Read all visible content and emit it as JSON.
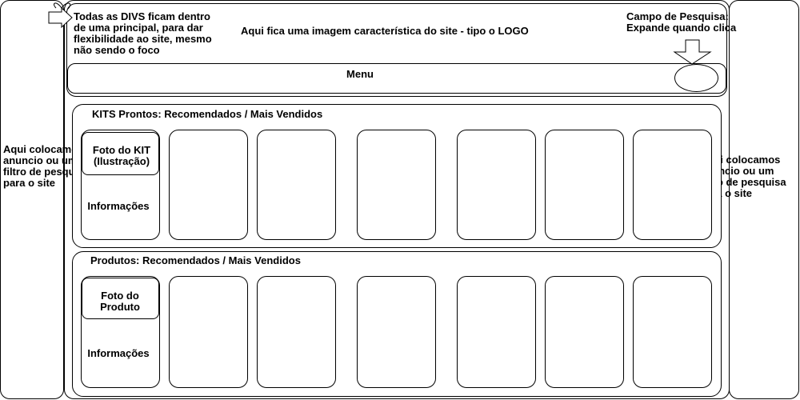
{
  "main_note": "Todas as DIVS ficam dentro\nde uma principal, para dar\nflexibilidade ao site, mesmo\nnão sendo o foco",
  "logo_note": "Aqui fica uma imagem característica do site - tipo o LOGO",
  "search_note": "Campo de Pesquisa:\nExpande quando clica",
  "menu_label": "Menu",
  "left_ad_note": "Aqui colocamos\nanuncio ou um\nfiltro de pesquisa\npara o site",
  "right_ad_note": "Aqui colocamos\nanuncio ou um\nfiltro de pesquisa\npara o site",
  "kits": {
    "title": "KITS Prontos: Recomendados / Mais Vendidos",
    "photo_label": "Foto do KIT\n(Ilustração)",
    "info_label": "Informações"
  },
  "produtos": {
    "title": "Produtos: Recomendados / Mais Vendidos",
    "photo_label": "Foto do\nProduto",
    "info_label": "Informações"
  }
}
